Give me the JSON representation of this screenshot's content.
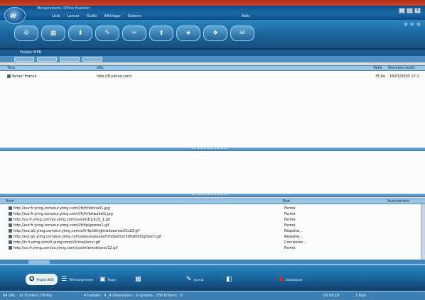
{
  "window": {
    "title": "Metaproducts Offline Explorer",
    "menu": [
      "Liste",
      "Lancer",
      "Outils",
      "Affichage",
      "Options"
    ],
    "aide": "Aide",
    "buttons": [
      "_",
      "□",
      "X"
    ]
  },
  "toolbar": {
    "buttons": [
      {
        "icon": "⚙",
        "label": ""
      },
      {
        "icon": "▦",
        "label": ""
      },
      {
        "icon": "⬇",
        "label": ""
      },
      {
        "icon": "✎",
        "label": ""
      },
      {
        "icon": "✂",
        "label": ""
      },
      {
        "icon": "⬆",
        "label": ""
      },
      {
        "icon": "★",
        "label": ""
      },
      {
        "icon": "❖",
        "label": ""
      },
      {
        "icon": "✉",
        "label": ""
      }
    ]
  },
  "address_label": "Projets WEB",
  "projects": {
    "columns": {
      "title": "Titre",
      "url": "URL",
      "size": "Taille",
      "date": "Dernière modif."
    },
    "rows": [
      {
        "title": "Yahoo! France",
        "url": "http://fr.yahoo.com/",
        "size": "35 Ko",
        "date": "16/05/2003 17:1"
      }
    ]
  },
  "downloads": {
    "columns": {
      "name": "Nom",
      "state": "Etat",
      "progress": "Avancement"
    },
    "rows": [
      {
        "url": "http://eur.fr.yimg.com/eur.yimg.com/i/fr/fr/bt/mail1.jpg",
        "state": "Fermé"
      },
      {
        "url": "http://eur.fr.yimg.com/eur.yimg.com/i/fr/fr/bt/wallet1.jpg",
        "state": "Fermé"
      },
      {
        "url": "http://us.fr.yimg.com/us.yimg.com/i/us/nt/b1/b15_1.gif",
        "state": "Fermé"
      },
      {
        "url": "http://eur.fr.yimg.com/eur.yimg.com/i/fr/fp/games1.gif",
        "state": "Fermé"
      },
      {
        "url": "http://eur.a1.yimg.com/eur.yimg.com/a/fr/fp/dtlrightsidearrow25x20.gif",
        "state": "Requête..."
      },
      {
        "url": "http://eur.a1.yimg.com/eur.yimg.com/a/eu/eu/eudo/fr/hpbutton300x60/hightech.gif",
        "state": "Requête..."
      },
      {
        "url": "http://fr.fr.yimg.com/fr.yimg.com/i/fr/mail/envi.gif",
        "state": "Connexion..."
      },
      {
        "url": "http://us.fr.yimg.com/us.yimg.com/i/us/nt/emoticons/12.gif",
        "state": "Fermé"
      }
    ]
  },
  "bottom_tabs": [
    {
      "icon": "✪",
      "label": "Projets WEB"
    },
    {
      "icon": "☰",
      "label": "Téléchargements"
    },
    {
      "icon": "▣",
      "label": "Pages"
    },
    {
      "icon": "▩",
      "label": ""
    },
    {
      "icon": "✎",
      "label": "Journal"
    },
    {
      "icon": "◧",
      "label": ""
    },
    {
      "icon": "◆",
      "label": "Statistiques"
    }
  ],
  "status": {
    "left": "84 URL - 31 Fichiers (79 Ko)",
    "middle": "4 traitant : 4 _4 réservation : 0 ignorés : 236 Erreurs : 0",
    "right1": "00:00:19",
    "right2": "3 Ko/s"
  }
}
